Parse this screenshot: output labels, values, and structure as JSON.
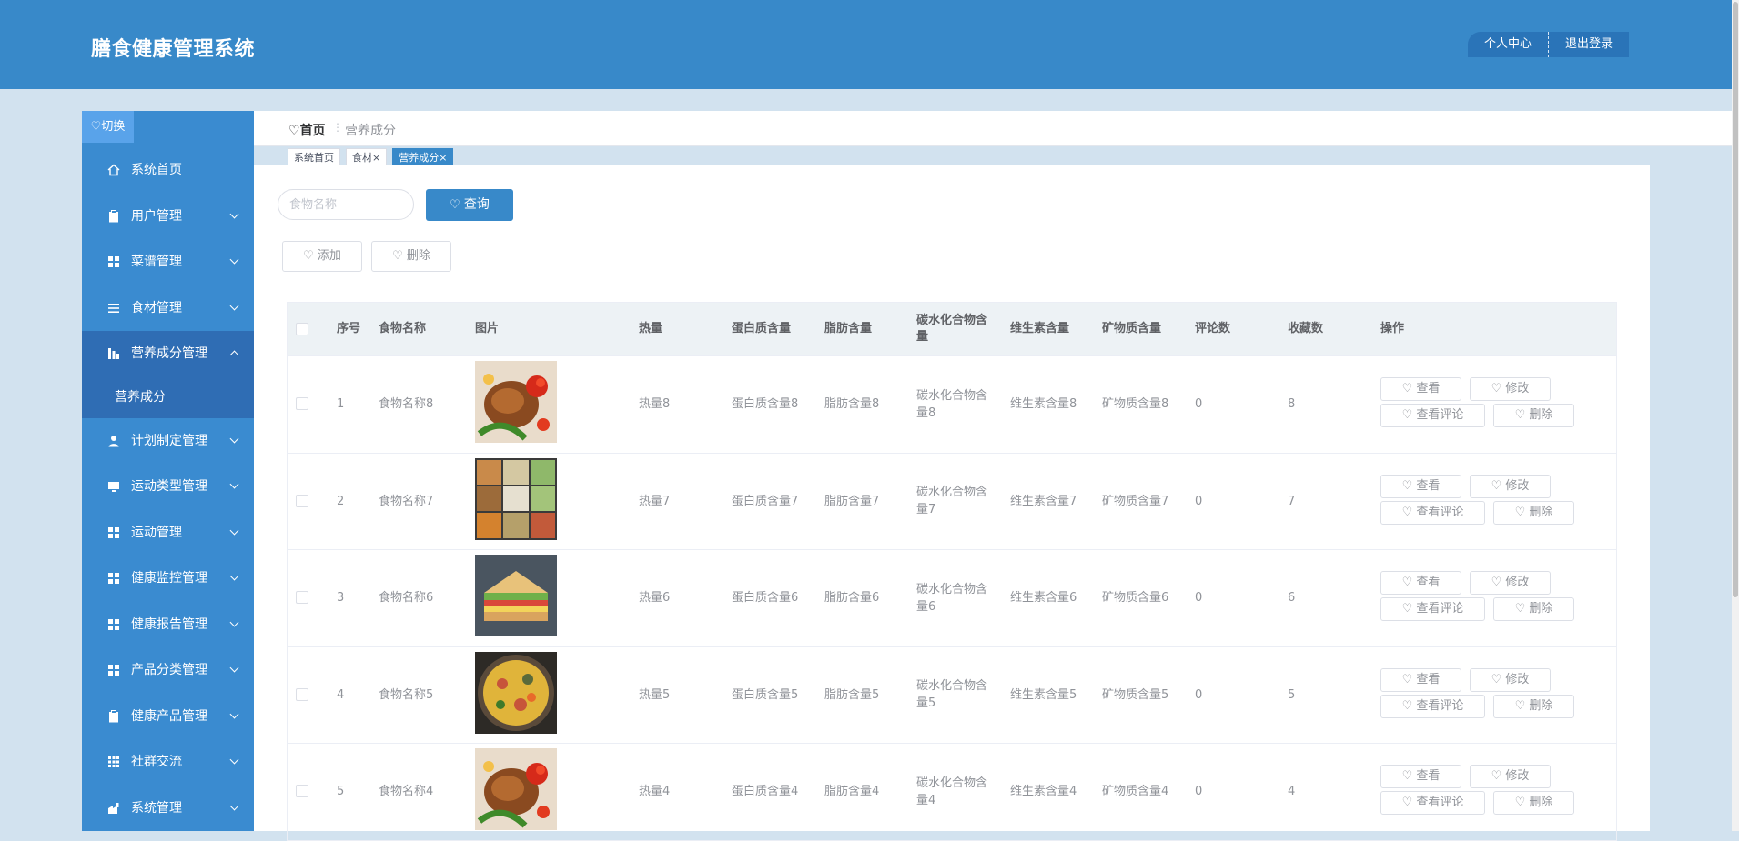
{
  "header": {
    "title": "膳食健康管理系统",
    "profile_label": "个人中心",
    "logout_label": "退出登录"
  },
  "sidebar": {
    "switch_label": "♡切换",
    "items": [
      {
        "label": "系统首页",
        "icon": "home-icon"
      },
      {
        "label": "用户管理",
        "icon": "clipboard-icon"
      },
      {
        "label": "菜谱管理",
        "icon": "grid-icon"
      },
      {
        "label": "食材管理",
        "icon": "list-icon"
      },
      {
        "label": "营养成分管理",
        "icon": "chart-icon"
      },
      {
        "label": "计划制定管理",
        "icon": "user-icon"
      },
      {
        "label": "运动类型管理",
        "icon": "monitor-icon"
      },
      {
        "label": "运动管理",
        "icon": "grid-icon"
      },
      {
        "label": "健康监控管理",
        "icon": "grid-icon"
      },
      {
        "label": "健康报告管理",
        "icon": "grid-icon"
      },
      {
        "label": "产品分类管理",
        "icon": "grid-icon"
      },
      {
        "label": "健康产品管理",
        "icon": "clipboard-icon"
      },
      {
        "label": "社群交流",
        "icon": "apps-icon"
      },
      {
        "label": "系统管理",
        "icon": "settings-icon"
      }
    ],
    "submenu_label": "营养成分"
  },
  "breadcrumb": {
    "home": "首页",
    "separator": "⋮",
    "current": "营养成分"
  },
  "tabs": [
    {
      "label": "系统首页"
    },
    {
      "label": "食材×"
    },
    {
      "label": "营养成分×"
    }
  ],
  "search": {
    "placeholder": "食物名称",
    "query_label": "查询"
  },
  "actions": {
    "add_label": "添加",
    "delete_label": "删除"
  },
  "table": {
    "headers": {
      "index": "序号",
      "name": "食物名称",
      "image": "图片",
      "heat": "热量",
      "protein": "蛋白质含量",
      "fat": "脂肪含量",
      "carb": "碳水化合物含量",
      "vitamin": "维生素含量",
      "mineral": "矿物质含量",
      "comments": "评论数",
      "favorites": "收藏数",
      "ops": "操作"
    },
    "rows": [
      {
        "index": "1",
        "name": "食物名称8",
        "heat": "热量8",
        "protein": "蛋白质含量8",
        "fat": "脂肪含量8",
        "carb": "碳水化合物含量8",
        "vitamin": "维生素含量8",
        "mineral": "矿物质含量8",
        "comments": "0",
        "favorites": "8",
        "image": "grilled-chicken-photo"
      },
      {
        "index": "2",
        "name": "食物名称7",
        "heat": "热量7",
        "protein": "蛋白质含量7",
        "fat": "脂肪含量7",
        "carb": "碳水化合物含量7",
        "vitamin": "维生素含量7",
        "mineral": "矿物质含量7",
        "comments": "0",
        "favorites": "7",
        "image": "food-collage-photo"
      },
      {
        "index": "3",
        "name": "食物名称6",
        "heat": "热量6",
        "protein": "蛋白质含量6",
        "fat": "脂肪含量6",
        "carb": "碳水化合物含量6",
        "vitamin": "维生素含量6",
        "mineral": "矿物质含量6",
        "comments": "0",
        "favorites": "6",
        "image": "sandwich-photo"
      },
      {
        "index": "4",
        "name": "食物名称5",
        "heat": "热量5",
        "protein": "蛋白质含量5",
        "fat": "脂肪含量5",
        "carb": "碳水化合物含量5",
        "vitamin": "维生素含量5",
        "mineral": "矿物质含量5",
        "comments": "0",
        "favorites": "5",
        "image": "paella-photo"
      },
      {
        "index": "5",
        "name": "食物名称4",
        "heat": "热量4",
        "protein": "蛋白质含量4",
        "fat": "脂肪含量4",
        "carb": "碳水化合物含量4",
        "vitamin": "维生素含量4",
        "mineral": "矿物质含量4",
        "comments": "0",
        "favorites": "4",
        "image": "grilled-chicken-photo"
      }
    ],
    "row_buttons": {
      "view": "查看",
      "edit": "修改",
      "comments": "查看评论",
      "delete": "删除"
    }
  },
  "colors": {
    "primary": "#3889c9",
    "sidebar": "#3a8bd0",
    "sidebar_active": "#2f6db4",
    "background": "#d2e2ef"
  }
}
